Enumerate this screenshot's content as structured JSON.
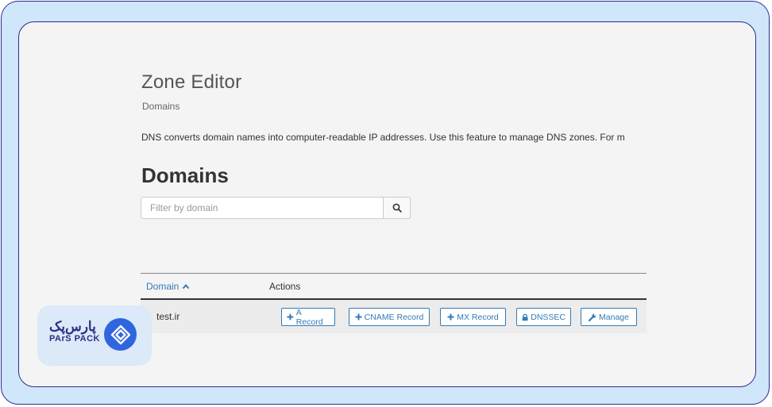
{
  "page": {
    "title": "Zone Editor",
    "breadcrumb": "Domains",
    "description": "DNS converts domain names into computer-readable IP addresses. Use this feature to manage DNS zones. For m"
  },
  "domains_section": {
    "title": "Domains",
    "filter_placeholder": "Filter by domain",
    "search_icon": "search-icon"
  },
  "table": {
    "columns": [
      {
        "label": "Domain",
        "sort": "ascending",
        "sort_icon": "chevron-up-icon"
      },
      {
        "label": "Actions"
      }
    ],
    "rows": [
      {
        "domain": "test.ir",
        "actions": [
          {
            "label": "A Record",
            "icon": "plus-icon"
          },
          {
            "label": "CNAME Record",
            "icon": "plus-icon"
          },
          {
            "label": "MX Record",
            "icon": "plus-icon"
          },
          {
            "label": "DNSSEC",
            "icon": "lock-icon"
          },
          {
            "label": "Manage",
            "icon": "wrench-icon"
          }
        ]
      }
    ]
  },
  "logo": {
    "persian": "پارس‌پک",
    "english": "PArS PACK",
    "icon": "parspack-logo-icon"
  },
  "colors": {
    "frame_outer": "#cfe6fb",
    "frame_border": "#2e2a8f",
    "link": "#337ab7",
    "logo_blue": "#2f66df"
  }
}
